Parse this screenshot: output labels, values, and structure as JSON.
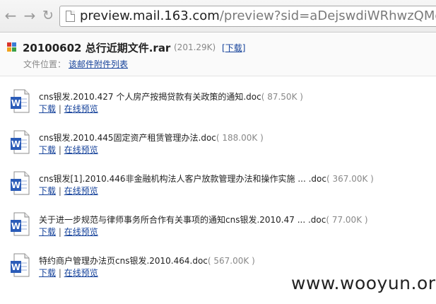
{
  "browser": {
    "url_host": "preview.mail.163.com",
    "url_path": "/preview?sid=aDejswdiWRhwzQMqzoiizaDCr"
  },
  "header": {
    "file_title": "20100602 总行近期文件.rar",
    "file_size": "(201.29K)",
    "download_label": "下载",
    "location_label": "文件位置：",
    "attachment_list_link": "该邮件附件列表"
  },
  "documents": [
    {
      "name": "cns银发.2010.427 个人房产按揭贷款有关政策的通知.doc",
      "size": "( 87.50K )",
      "download": "下载",
      "preview": "在线预览"
    },
    {
      "name": "cns银发.2010.445固定资产租赁管理办法.doc",
      "size": "( 188.00K )",
      "download": "下载",
      "preview": "在线预览"
    },
    {
      "name": "cns银发[1].2010.446非金融机构法人客户放款管理办法和操作实施 ... .doc",
      "size": "( 367.00K )",
      "download": "下载",
      "preview": "在线预览"
    },
    {
      "name": "关于进一步规范与律师事务所合作有关事项的通知cns银发.2010.47 ... .doc",
      "size": "( 77.00K )",
      "download": "下载",
      "preview": "在线预览"
    },
    {
      "name": "特约商户管理办法页cns银发.2010.464.doc",
      "size": "( 567.00K )",
      "download": "下载",
      "preview": "在线预览"
    }
  ],
  "link_separator": "|",
  "watermark": "www.wooyun.org",
  "colors": {
    "link": "#14419a",
    "doc_icon_blue": "#2b5cb8",
    "muted_text": "#888888"
  }
}
